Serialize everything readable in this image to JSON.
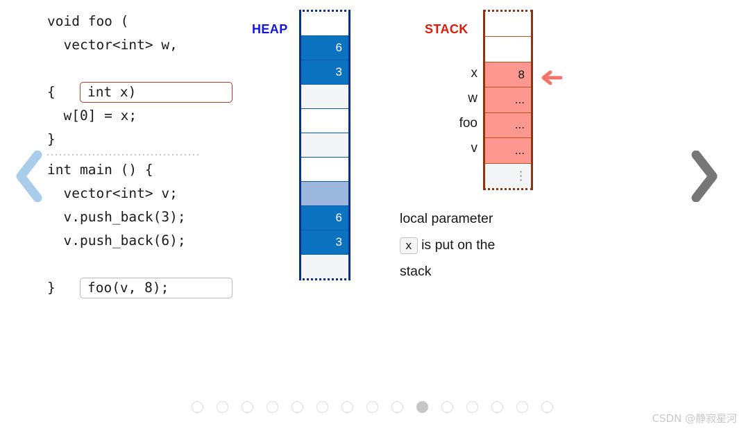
{
  "nav": {
    "prev_icon": "chevron-left-icon",
    "next_icon": "chevron-right-icon",
    "prev_color": "#a9cdeb",
    "next_color": "#767676"
  },
  "code": {
    "foo": [
      {
        "text": "void foo (",
        "boxed": "none"
      },
      {
        "text": "  vector<int> w,",
        "boxed": "none"
      },
      {
        "text": "int x)",
        "boxed": "red"
      },
      {
        "text": "{",
        "boxed": "none"
      },
      {
        "text": "  w[0] = x;",
        "boxed": "none"
      },
      {
        "text": "}",
        "boxed": "none"
      }
    ],
    "main": [
      {
        "text": "int main () {",
        "boxed": "none"
      },
      {
        "text": "  vector<int> v;",
        "boxed": "none"
      },
      {
        "text": "  v.push_back(3);",
        "boxed": "none"
      },
      {
        "text": "  v.push_back(6);",
        "boxed": "none"
      },
      {
        "text": "foo(v, 8);",
        "boxed": "grey"
      },
      {
        "text": "}",
        "boxed": "none"
      }
    ]
  },
  "heap": {
    "label": "HEAP",
    "label_color": "#1414e0",
    "border_color": "#0b2f8a",
    "cells": [
      {
        "value": "",
        "style": "hc-white"
      },
      {
        "value": "6",
        "style": "hc-blue"
      },
      {
        "value": "3",
        "style": "hc-blue"
      },
      {
        "value": "",
        "style": "hc-offw"
      },
      {
        "value": "",
        "style": "hc-white"
      },
      {
        "value": "",
        "style": "hc-offw"
      },
      {
        "value": "",
        "style": "hc-white"
      },
      {
        "value": "",
        "style": "hc-ltblue"
      },
      {
        "value": "6",
        "style": "hc-blue"
      },
      {
        "value": "3",
        "style": "hc-blue"
      },
      {
        "value": "",
        "style": "hc-offw"
      }
    ]
  },
  "stack": {
    "label": "STACK",
    "label_color": "#e01b0b",
    "border_color": "#8c3310",
    "cells": [
      {
        "value": "",
        "style": "sc-white",
        "label": ""
      },
      {
        "value": "",
        "style": "sc-white",
        "label": ""
      },
      {
        "value": "8",
        "style": "sc-pink",
        "label": "x"
      },
      {
        "value": "...",
        "style": "sc-pink",
        "label": "w"
      },
      {
        "value": "...",
        "style": "sc-pink",
        "label": "foo"
      },
      {
        "value": "...",
        "style": "sc-pink",
        "label": "v"
      },
      {
        "value": "vdots",
        "style": "sc-offw",
        "label": ""
      }
    ],
    "row_labels": [
      "x",
      "w",
      "foo",
      "v"
    ],
    "pointer_icon": "arrow-left-icon",
    "pointer_color": "#f2756b"
  },
  "caption": {
    "line1": "local parameter",
    "code_token": "x",
    "line2_rest": "is put on the",
    "line3": "stack"
  },
  "pagination": {
    "total": 15,
    "active_index": 10
  },
  "watermark": {
    "text": "CSDN @静寂星河"
  }
}
